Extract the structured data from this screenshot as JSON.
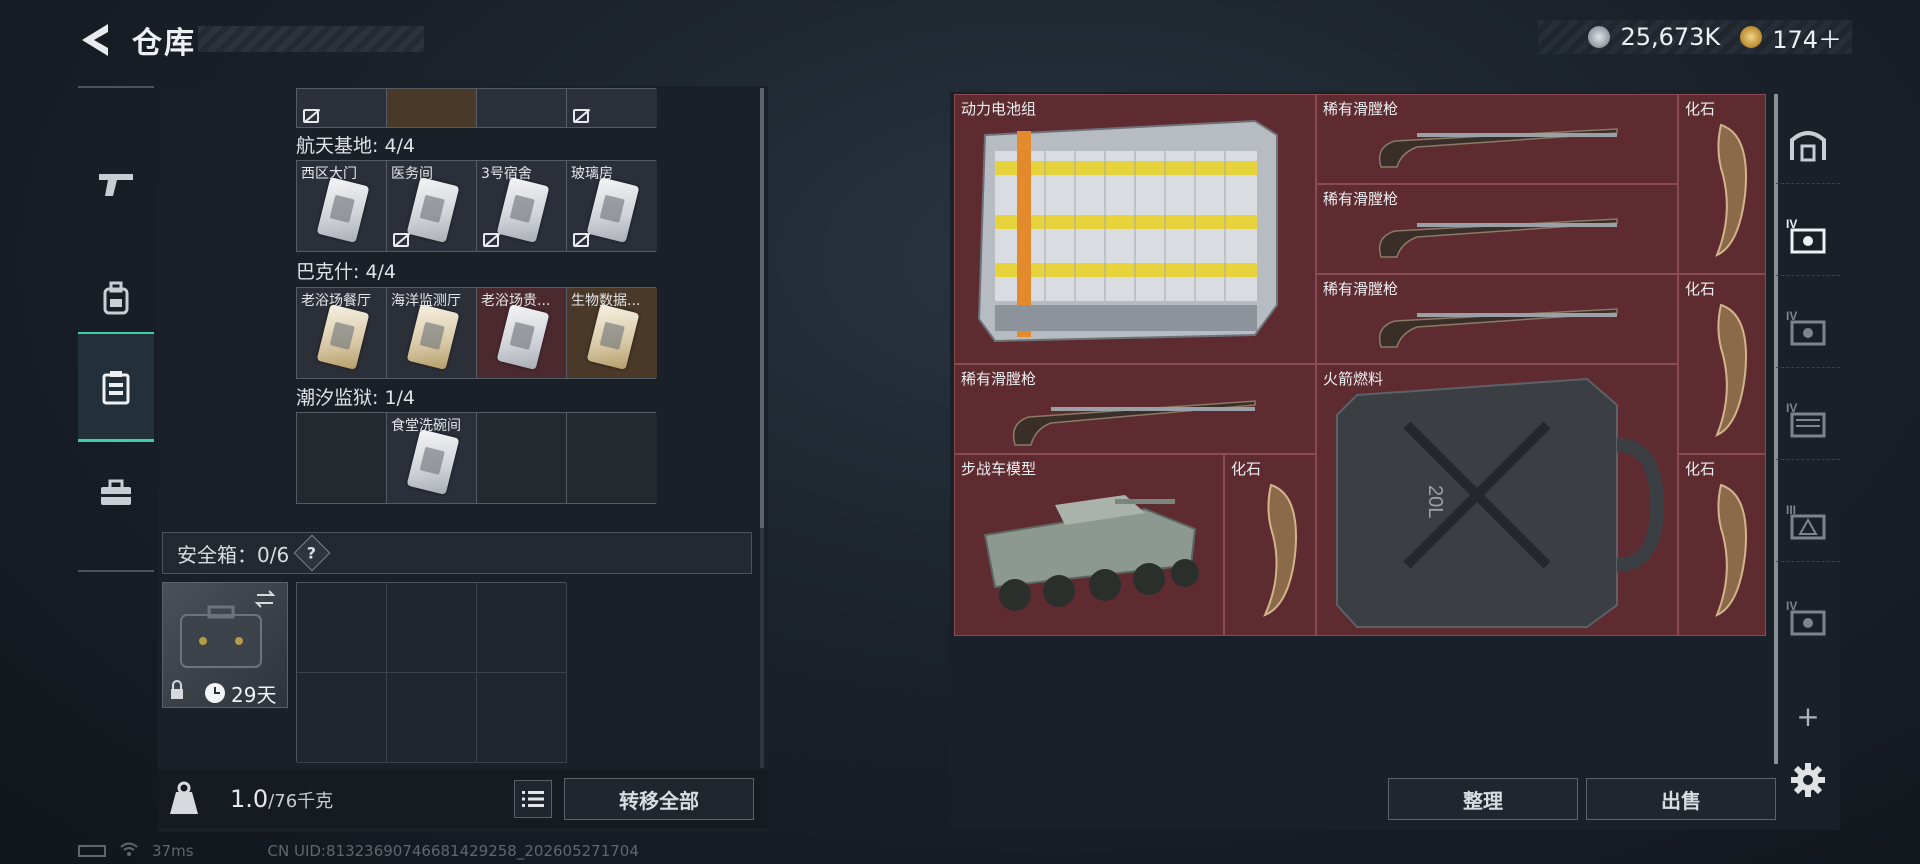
{
  "header": {
    "title": "仓库"
  },
  "currency": [
    {
      "icon": "silver-coin-icon",
      "value": "25,673K",
      "color": "#b8c0c8"
    },
    {
      "icon": "gold-triangle-coin-icon",
      "value": "174＋",
      "color": "#c9a24a"
    }
  ],
  "left_nav": [
    {
      "icon": "pistol-icon",
      "active": false
    },
    {
      "icon": "backpack-icon",
      "active": false
    },
    {
      "icon": "keycard-case-icon",
      "active": true
    },
    {
      "icon": "toolbox-icon",
      "active": false
    }
  ],
  "key_groups": [
    {
      "title": "航天基地: 4/4",
      "cells": [
        {
          "label": "西区大门",
          "filled": true,
          "locked": false
        },
        {
          "label": "医务间",
          "filled": true,
          "locked": true
        },
        {
          "label": "3号宿舍",
          "filled": true,
          "locked": true
        },
        {
          "label": "玻璃房",
          "filled": true,
          "locked": true
        }
      ]
    },
    {
      "title": "巴克什: 4/4",
      "cells": [
        {
          "label": "老浴场餐厅",
          "filled": true,
          "locked": false
        },
        {
          "label": "海洋监测厅",
          "filled": true,
          "locked": false
        },
        {
          "label": "老浴场贵...",
          "filled": true,
          "locked": false
        },
        {
          "label": "生物数据...",
          "filled": true,
          "locked": false
        }
      ]
    },
    {
      "title": "潮汐监狱: 1/4",
      "cells": [
        {
          "label": "",
          "filled": false
        },
        {
          "label": "食堂洗碗间",
          "filled": true,
          "locked": false
        },
        {
          "label": "",
          "filled": false
        },
        {
          "label": "",
          "filled": false
        }
      ]
    }
  ],
  "safebox": {
    "label": "安全箱：0/6",
    "help": "?",
    "timer": "29天"
  },
  "weight": {
    "current": "1.0",
    "capacity": "/76千克"
  },
  "buttons": {
    "transfer_all": "转移全部",
    "sort": "整理",
    "sell": "出售",
    "add": "+"
  },
  "stash_items": [
    {
      "name": "动力电池组",
      "icon": "battery-pack-icon"
    },
    {
      "name": "稀有滑膛枪",
      "icon": "musket-icon"
    },
    {
      "name": "化石",
      "icon": "fossil-claw-icon"
    },
    {
      "name": "稀有滑膛枪",
      "icon": "musket-icon"
    },
    {
      "name": "稀有滑膛枪",
      "icon": "musket-icon"
    },
    {
      "name": "化石",
      "icon": "fossil-claw-icon"
    },
    {
      "name": "稀有滑膛枪",
      "icon": "musket-icon"
    },
    {
      "name": "火箭燃料",
      "icon": "fuel-canister-icon",
      "canister_text": "20L"
    },
    {
      "name": "步战车模型",
      "icon": "ifv-model-icon"
    },
    {
      "name": "化石",
      "icon": "fossil-claw-icon"
    },
    {
      "name": "化石",
      "icon": "fossil-claw-icon"
    }
  ],
  "right_nav": [
    "stash-page-icon",
    "stash-tab-iv-icon",
    "stash-tab-iv-icon",
    "stash-tab-iv-icon",
    "stash-tab-iii-icon",
    "stash-tab-iv-icon"
  ],
  "status_bar": {
    "ping": "37ms",
    "uid": "CN UID:813236907466814292​58_202605271704"
  }
}
